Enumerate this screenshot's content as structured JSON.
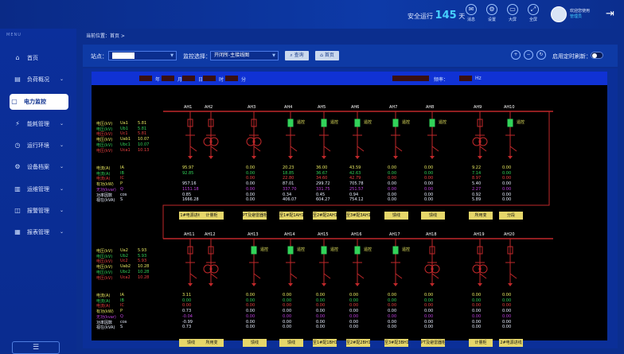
{
  "header": {
    "safe_label": "安全运行",
    "safe_days": "145",
    "safe_unit": "天",
    "buttons": [
      {
        "label": "消息",
        "icon": "message-icon"
      },
      {
        "label": "设置",
        "icon": "settings-icon"
      },
      {
        "label": "大屏",
        "icon": "screen-icon"
      },
      {
        "label": "全屏",
        "icon": "fullscreen-icon"
      }
    ],
    "welcome": "欢迎您使用",
    "user": "管理员"
  },
  "sidebar": {
    "title": "MENU",
    "items": [
      {
        "label": "首页",
        "icon": "home-icon",
        "arrow": ""
      },
      {
        "label": "负荷概况",
        "icon": "load-icon",
        "arrow": "⌄"
      },
      {
        "label": "电力监控",
        "icon": "monitor-icon",
        "arrow": ""
      },
      {
        "label": "能耗管理",
        "icon": "energy-icon",
        "arrow": "⌄"
      },
      {
        "label": "运行环境",
        "icon": "environment-icon",
        "arrow": "⌄"
      },
      {
        "label": "设备档案",
        "icon": "device-icon",
        "arrow": "⌄"
      },
      {
        "label": "运维管理",
        "icon": "maintenance-icon",
        "arrow": "⌄"
      },
      {
        "label": "报警管理",
        "icon": "alarm-icon",
        "arrow": "⌄"
      },
      {
        "label": "报表管理",
        "icon": "report-icon",
        "arrow": "⌄"
      }
    ]
  },
  "breadcrumb": "当前位置：首页 >",
  "filter": {
    "station_label": "站点：",
    "monitor_label": "监控选择：",
    "monitor_value": "开闭所-主接线图",
    "query": "查询",
    "home": "首页",
    "timer_label": "启用定时刷新："
  },
  "diagram": {
    "time_units": [
      "年",
      "月",
      "日",
      "时",
      "分"
    ],
    "freq_label": "频率：",
    "freq_unit": "Hz",
    "top_labels": [
      {
        "t": "电压(kV)",
        "c": "#e8e860"
      },
      {
        "t": "电压(kV)",
        "c": "#32d35a"
      },
      {
        "t": "电压(kV)",
        "c": "#e84040"
      },
      {
        "t": "电压(kV)",
        "c": "#e8e860"
      },
      {
        "t": "电压(kV)",
        "c": "#32d35a"
      },
      {
        "t": "电压(kV)",
        "c": "#e84040"
      }
    ],
    "top_syms": [
      "Ua1",
      "Ub1",
      "Uc1",
      "Uab1",
      "Ubc1",
      "Uca1"
    ],
    "top_vals": [
      "5.81",
      "5.81",
      "5.81",
      "10.07",
      "10.07",
      "10.13"
    ],
    "bot_syms": [
      "Ua2",
      "Ub2",
      "Uc2",
      "Uab2",
      "Ubc2",
      "Uca2"
    ],
    "bot_vals": [
      "5.93",
      "5.93",
      "5.93",
      "10.28",
      "10.28",
      "10.28"
    ],
    "meas_labels": [
      {
        "t": "电流(A)",
        "c": "#e8e860"
      },
      {
        "t": "电流(A)",
        "c": "#32d35a"
      },
      {
        "t": "电流(A)",
        "c": "#e84040"
      },
      {
        "t": "有功(kW)",
        "c": "#e8e860"
      },
      {
        "t": "无功(kvar)",
        "c": "#c040e0"
      },
      {
        "t": "功率因数",
        "c": "#e8eeff"
      },
      {
        "t": "视在(kVA)",
        "c": "#e8eeff"
      }
    ],
    "meas_syms": [
      "IA",
      "IB",
      "IC",
      "P",
      "Q",
      "cos",
      "S"
    ],
    "top_cabinets": [
      "AH1",
      "AH2",
      "AH3",
      "AH4",
      "AH5",
      "AH6",
      "AH7",
      "AH8",
      "AH9",
      "AH10"
    ],
    "bot_cabinets": [
      "AH11",
      "AH12",
      "AH13",
      "AH14",
      "AH15",
      "AH16",
      "AH17",
      "AH18",
      "AH19",
      "AH20"
    ],
    "top_values": [
      [
        "95.97",
        "92.85",
        "",
        "957.16",
        "1151.18",
        "0.85",
        "1666.28"
      ],
      [
        "",
        "",
        "",
        "",
        "",
        "",
        ""
      ],
      [
        "0.00",
        "0.00",
        "0.00",
        "0.00",
        "0.00",
        "0.00",
        "0.00"
      ],
      [
        "20.23",
        "18.85",
        "22.80",
        "87.01",
        "337.70",
        "0.34",
        "406.07"
      ],
      [
        "36.00",
        "36.67",
        "34.60",
        "299.72",
        "331.75",
        "0.45",
        "604.27"
      ],
      [
        "43.59",
        "42.63",
        "42.79",
        "705.78",
        "251.57",
        "0.94",
        "754.12"
      ],
      [
        "0.00",
        "0.00",
        "0.00",
        "0.00",
        "0.00",
        "0.00",
        "0.00"
      ],
      [
        "0.00",
        "0.00",
        "0.00",
        "0.00",
        "0.00",
        "0.00",
        "0.00"
      ],
      [
        "9.22",
        "7.14",
        "8.97",
        "5.40",
        "2.27",
        "0.92",
        "5.89"
      ],
      [
        "0.00",
        "0.00",
        "0.00",
        "0.00",
        "0.00",
        "0.00",
        "0.00"
      ]
    ],
    "bot_values": [
      [
        "3.11",
        "0.00",
        "0.00",
        "0.73",
        "-0.04",
        "-0.99",
        "0.73"
      ],
      [
        "",
        "",
        "",
        "",
        "",
        "",
        ""
      ],
      [
        "0.00",
        "0.00",
        "0.00",
        "0.00",
        "0.00",
        "0.00",
        "0.00"
      ],
      [
        "0.00",
        "0.00",
        "0.00",
        "0.00",
        "0.00",
        "0.00",
        "0.00"
      ],
      [
        "0.00",
        "0.00",
        "0.00",
        "0.00",
        "0.00",
        "0.00",
        "0.00"
      ],
      [
        "0.00",
        "0.00",
        "0.00",
        "0.00",
        "0.00",
        "0.00",
        "0.00"
      ],
      [
        "0.00",
        "0.00",
        "0.00",
        "0.00",
        "0.00",
        "0.00",
        "0.00"
      ],
      [
        "0.00",
        "0.00",
        "0.00",
        "0.00",
        "0.00",
        "0.00",
        "0.00"
      ],
      [
        "0.00",
        "0.00",
        "0.00",
        "0.00",
        "0.00",
        "0.00",
        "0.00"
      ],
      [
        "0.00",
        "0.00",
        "0.00",
        "0.00",
        "0.00",
        "0.00",
        "0.00"
      ]
    ],
    "top_buttons": [
      "1#电源进线",
      "计量柜",
      "PT及避雷器柜",
      "至1#配1AH1柜",
      "至2#配2AH1柜",
      "至3#配3AH1柜",
      "馈线",
      "馈线",
      "所用变",
      "分段"
    ],
    "bot_buttons": [
      "馈线",
      "所用变",
      "馈线",
      "馈线",
      "至1#配1BH1柜",
      "至2#配2BH1柜",
      "至3#配3BH1柜",
      "PT及避雷器柜",
      "计量柜",
      "2#电源进线"
    ],
    "tag": "遥控",
    "colors": {
      "bus": "#c0282a",
      "closed": "#32d35a",
      "value_top_green": "#32d35a"
    }
  }
}
